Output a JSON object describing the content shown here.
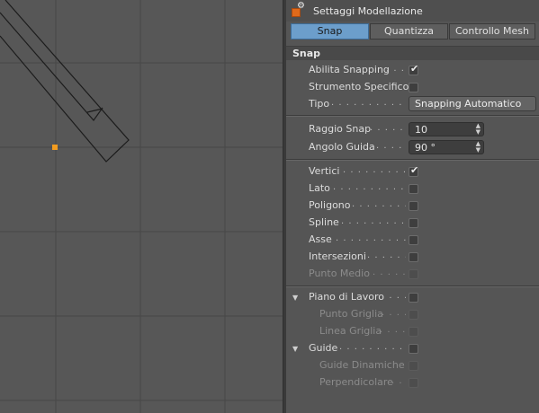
{
  "panel": {
    "title": "Settaggi Modellazione",
    "title_icon": "modeling-settings-icon",
    "tabs": [
      {
        "label": "Snap",
        "active": true
      },
      {
        "label": "Quantizza",
        "active": false
      },
      {
        "label": "Controllo Mesh",
        "active": false
      }
    ],
    "section_title": "Snap",
    "enable_snapping": {
      "label": "Abilita Snapping",
      "dots": ". . . .",
      "checked": true
    },
    "specific_tool": {
      "label": "Strumento Specifico",
      "dots": "",
      "checked": false
    },
    "type": {
      "label": "Tipo",
      "dots": ". . . . . . . . . . . . . . .",
      "value": "Snapping Automatico"
    },
    "snap_radius": {
      "label": "Raggio Snap",
      "dots": ". . . . . . .",
      "value": "10"
    },
    "guide_angle": {
      "label": "Angolo Guida",
      "dots": ". . . . . .",
      "value": "90 °"
    },
    "snap_targets": [
      {
        "label": "Vertici",
        "dots": ". . . . . . . . . . . . .",
        "checked": true
      },
      {
        "label": "Lato",
        "dots": ". . . . . . . . . . . . . .",
        "checked": false
      },
      {
        "label": "Poligono",
        "dots": ". . . . . . . . . . . .",
        "checked": false
      },
      {
        "label": "Spline",
        "dots": ". . . . . . . . . . . . .",
        "checked": false
      },
      {
        "label": "Asse",
        "dots": ". . . . . . . . . . . . . .",
        "checked": false
      },
      {
        "label": "Intersezioni",
        "dots": ". . . . . . . . . .",
        "checked": false
      },
      {
        "label": "Punto Medio",
        "dots": ". . . . . . . .",
        "checked": false,
        "disabled": true
      }
    ],
    "workplane": {
      "label": "Piano di Lavoro",
      "dots": ". . . . .",
      "checked": false,
      "expanded": true
    },
    "grid_point": {
      "label": "Punto Griglia",
      "dots": ". . . . .",
      "checked": false,
      "disabled": true
    },
    "grid_line": {
      "label": "Linea Griglia",
      "dots": ". . . . .",
      "checked": false,
      "disabled": true
    },
    "guides": {
      "label": "Guide",
      "dots": ". . . . . . . . . . . . . .",
      "checked": false,
      "expanded": true
    },
    "dynamic_guides": {
      "label": "Guide Dinamiche",
      "dots": "",
      "checked": false,
      "disabled": true
    },
    "perpendicular": {
      "label": "Perpendicolare",
      "dots": ". .",
      "checked": false,
      "disabled": true
    }
  },
  "viewport": {
    "selected_point_color": "#f39c1f",
    "accent": "#6c9ecb"
  }
}
